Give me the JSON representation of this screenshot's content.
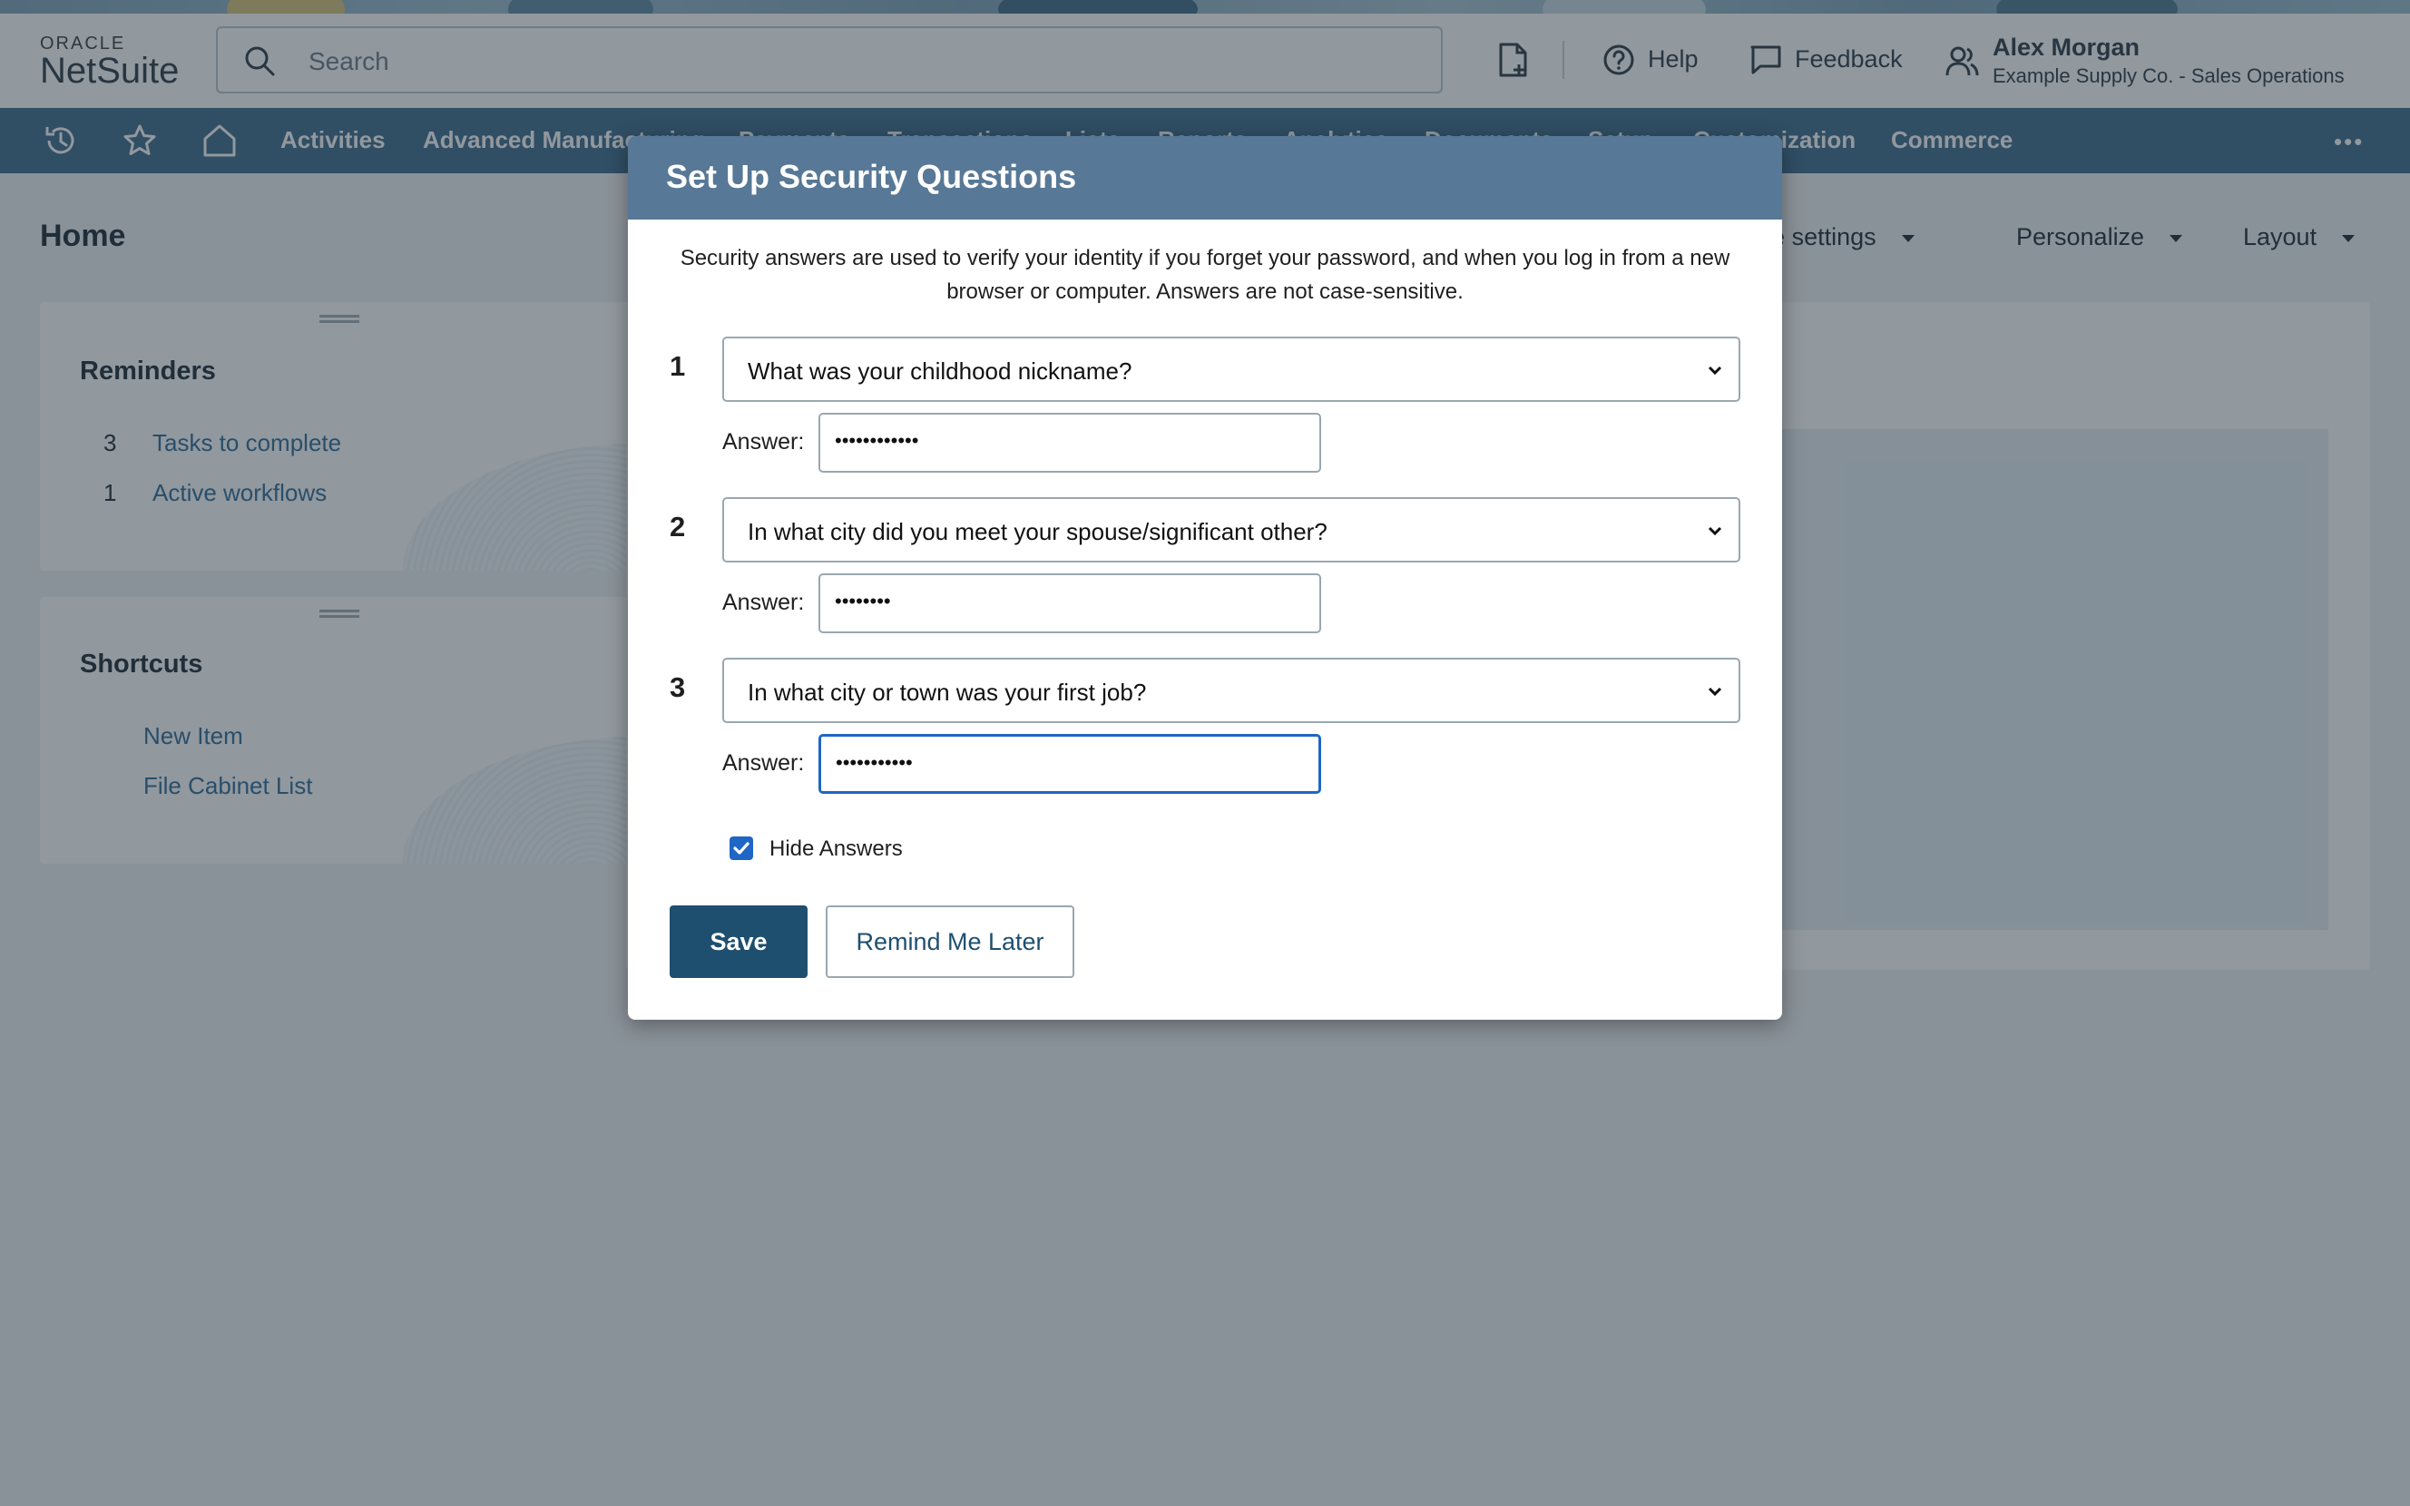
{
  "brand": {
    "oracle": "ORACLE",
    "netsuite": "NetSuite"
  },
  "header": {
    "search_placeholder": "Search",
    "help": "Help",
    "feedback": "Feedback",
    "user_name": "Alex Morgan",
    "user_company": "Example Supply Co.  -  Sales Operations"
  },
  "nav": {
    "items": [
      "Activities",
      "Advanced Manufacturing",
      "Payments",
      "Transactions",
      "Lists",
      "Reports",
      "Analytics",
      "Documents",
      "Setup",
      "Customization",
      "Commerce"
    ],
    "more": "•••"
  },
  "page": {
    "title": "Home",
    "tools": {
      "settings": "Update settings",
      "personalize": "Personalize",
      "layout": "Layout"
    }
  },
  "reminders": {
    "title": "Reminders",
    "rows": [
      {
        "count": "3",
        "label": "Tasks to complete"
      },
      {
        "count": "1",
        "label": "Active workflows"
      }
    ]
  },
  "shortcuts": {
    "title": "Shortcuts",
    "links": [
      "New Item",
      "File Cabinet List"
    ]
  },
  "modal": {
    "title": "Set Up Security Questions",
    "description": "Security answers are used to verify your identity if you forget your password, and when you log in from a new browser or computer. Answers are not case-sensitive.",
    "answer_label": "Answer:",
    "questions": [
      {
        "number": "1",
        "question": "What was your childhood nickname?",
        "answer_mask": "••••••••••••"
      },
      {
        "number": "2",
        "question": "In what city did you meet your spouse/significant other?",
        "answer_mask": "••••••••"
      },
      {
        "number": "3",
        "question": "In what city or town was your first job?",
        "answer_mask": "•••••••••••"
      }
    ],
    "hide_answers_label": "Hide Answers",
    "hide_answers_checked": true,
    "save_label": "Save",
    "remind_label": "Remind Me Later"
  },
  "colors": {
    "nav_bg": "#3c6a8a",
    "modal_header": "#577896",
    "primary_button": "#1f4f6e",
    "link": "#2e6b97",
    "focus": "#1f66c6"
  }
}
